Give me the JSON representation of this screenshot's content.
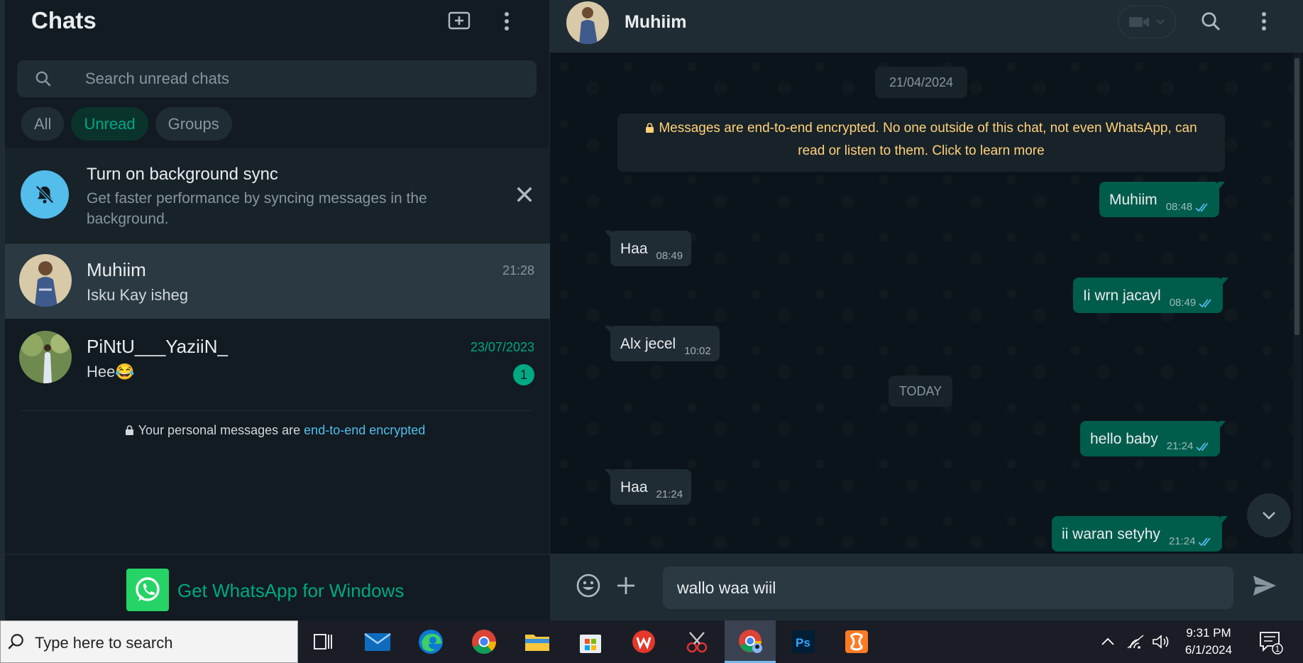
{
  "sidebar": {
    "title": "Chats",
    "new_chat_icon": "new-chat-icon",
    "menu_icon": "more-vertical-icon",
    "search_placeholder": "Search unread chats",
    "filters": [
      {
        "label": "All",
        "active": false
      },
      {
        "label": "Unread",
        "active": true
      },
      {
        "label": "Groups",
        "active": false
      }
    ],
    "sync_banner": {
      "title": "Turn on background sync",
      "description": "Get faster performance by syncing messages in the background.",
      "icon": "bell-off-icon"
    },
    "chats": [
      {
        "name": "Muhiim",
        "preview": "Isku Kay isheg",
        "time": "21:28",
        "selected": true
      },
      {
        "name": "PiNtU___YaziiN_",
        "preview": "Hee😂",
        "time": "23/07/2023",
        "unread_count": "1"
      }
    ],
    "encryption_note": {
      "prefix": "Your personal messages are ",
      "link": "end-to-end encrypted"
    },
    "get_app": "Get WhatsApp for Windows"
  },
  "conversation": {
    "contact_name": "Muhiim",
    "date_labels": [
      "21/04/2024",
      "TODAY"
    ],
    "system_message": "Messages are end-to-end encrypted. No one outside of this chat, not even WhatsApp, can read or listen to them. Click to learn more",
    "messages": [
      {
        "direction": "out",
        "text": "Muhiim",
        "time": "08:48",
        "status": "read"
      },
      {
        "direction": "in",
        "text": "Haa",
        "time": "08:49"
      },
      {
        "direction": "out",
        "text": "Ii wrn jacayl",
        "time": "08:49",
        "status": "read"
      },
      {
        "direction": "in",
        "text": "Alx jecel",
        "time": "10:02"
      },
      {
        "direction": "out",
        "text": "hello baby",
        "time": "21:24",
        "status": "read"
      },
      {
        "direction": "in",
        "text": "Haa",
        "time": "21:24"
      },
      {
        "direction": "out",
        "text": "ii waran setyhy",
        "time": "21:24",
        "status": "read"
      }
    ],
    "composer": {
      "value": "wallo waa wiil"
    }
  },
  "taskbar": {
    "search_placeholder": "Type here to search",
    "apps": [
      "task-view",
      "mail",
      "edge",
      "chrome",
      "file-explorer",
      "microsoft-store",
      "wps-office",
      "snipping-tool",
      "chrome-active",
      "photoshop",
      "xampp"
    ],
    "clock": {
      "time": "9:31 PM",
      "date": "6/1/2024"
    },
    "notification_count": "1"
  },
  "colors": {
    "panel_bg": "#111b21",
    "header_bg": "#202c33",
    "accent": "#00a884",
    "outgoing_bubble": "#005c4b",
    "incoming_bubble": "#202c33",
    "system_text": "#ffd279",
    "link": "#53bdeb"
  }
}
